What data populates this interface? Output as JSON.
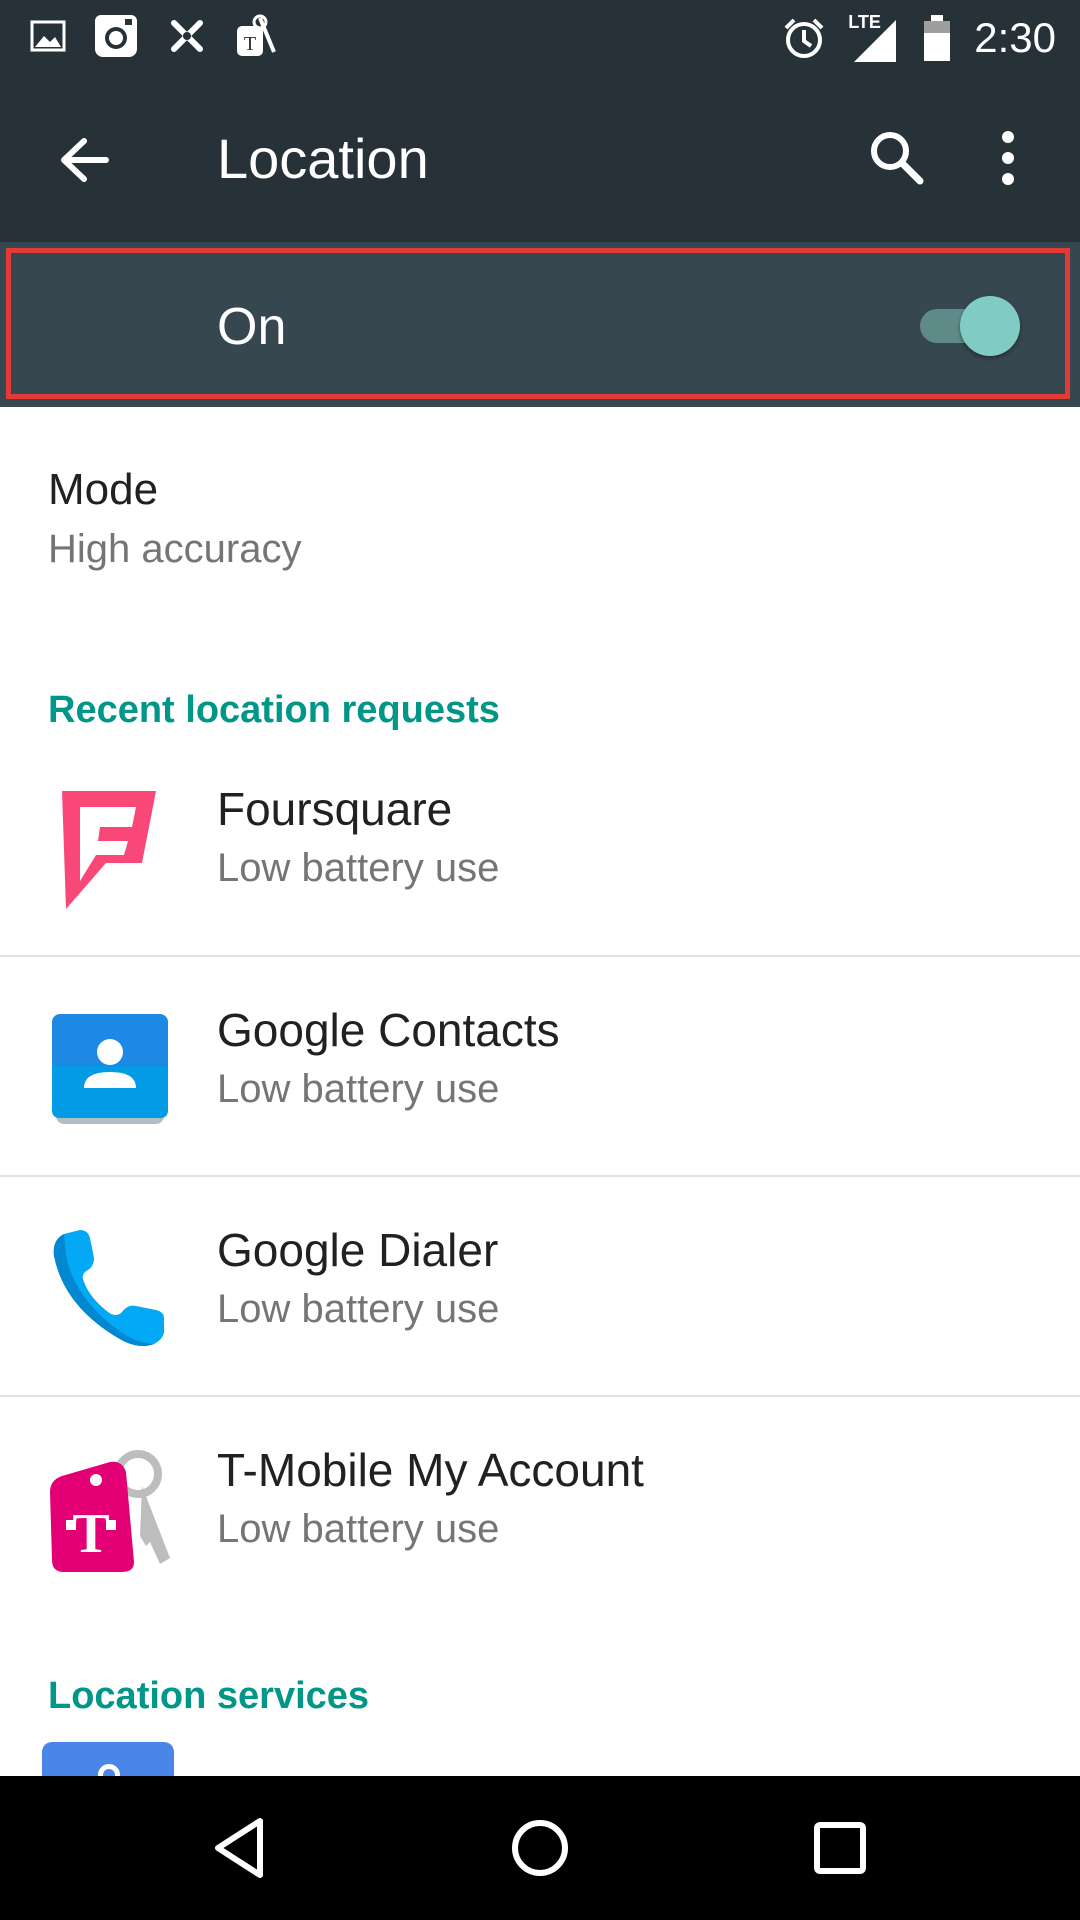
{
  "status_bar": {
    "time": "2:30",
    "network": "LTE",
    "left_icons": [
      "gallery-icon",
      "instagram-icon",
      "app-icon",
      "tmobile-icon"
    ],
    "right_icons": [
      "alarm-icon",
      "signal-icon",
      "battery-icon"
    ]
  },
  "toolbar": {
    "title": "Location",
    "icons": [
      "back-arrow-icon",
      "search-icon",
      "more-vert-icon"
    ]
  },
  "master_switch": {
    "label": "On",
    "checked": true,
    "colors": {
      "track": "#5e8b88",
      "thumb": "#80cbc4",
      "highlight": "#e53935"
    }
  },
  "mode": {
    "title": "Mode",
    "value": "High accuracy"
  },
  "recent_requests": {
    "header": "Recent location requests",
    "apps": [
      {
        "name": "Foursquare",
        "usage": "Low battery use",
        "icon": "foursquare-icon"
      },
      {
        "name": "Google Contacts",
        "usage": "Low battery use",
        "icon": "contacts-icon"
      },
      {
        "name": "Google Dialer",
        "usage": "Low battery use",
        "icon": "phone-icon"
      },
      {
        "name": "T-Mobile My Account",
        "usage": "Low battery use",
        "icon": "tmobile-key-icon"
      }
    ]
  },
  "location_services": {
    "header": "Location services"
  },
  "nav_bar": {
    "icons": [
      "back-triangle-icon",
      "home-circle-icon",
      "recents-square-icon"
    ]
  },
  "colors": {
    "primary_dark": "#263238",
    "switch_bar": "#37474f",
    "accent": "#009688"
  }
}
